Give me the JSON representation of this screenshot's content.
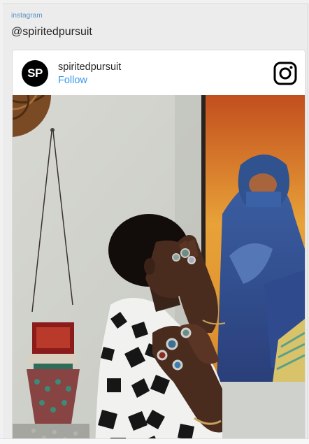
{
  "embed": {
    "source_label": "instagram",
    "handle": "@spiritedpursuit"
  },
  "post": {
    "avatar_initials": "SP",
    "username": "spiritedpursuit",
    "follow_label": "Follow",
    "icon": "instagram-logo-icon"
  },
  "photo": {
    "icon": "post-photo"
  },
  "colors": {
    "link": "#3897f0",
    "label": "#5b8fc3",
    "text": "#262626"
  }
}
